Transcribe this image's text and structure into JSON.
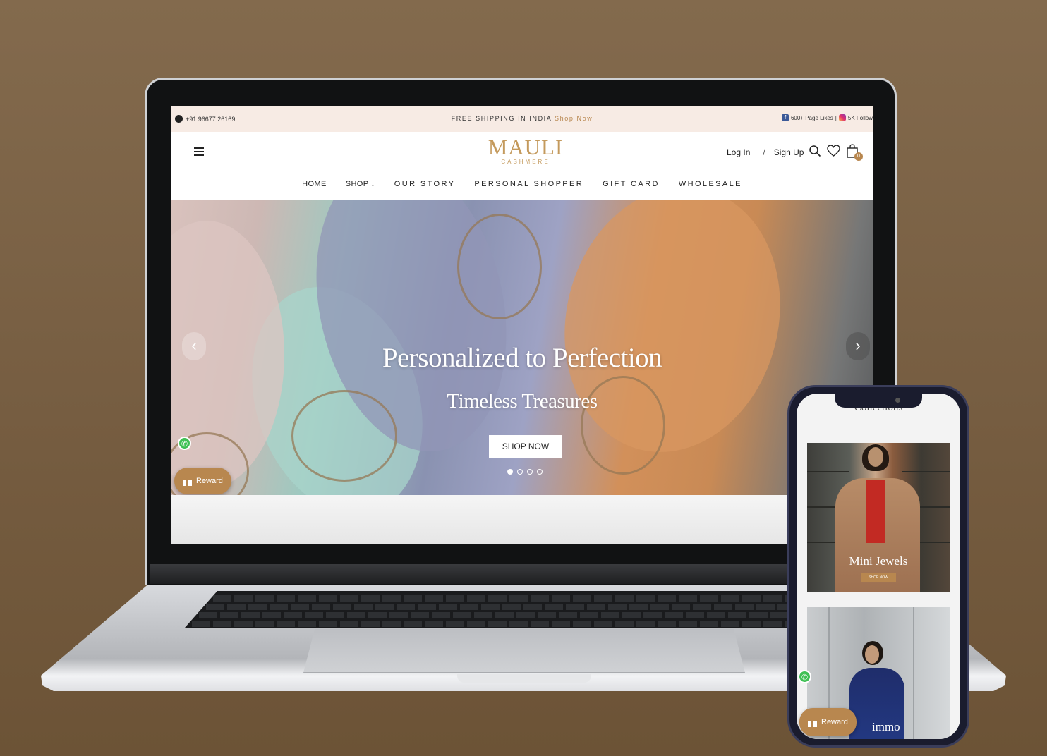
{
  "announcement": {
    "phone": "+91 96677 26169",
    "shipping_text": "FREE SHIPPING IN INDIA",
    "shipping_link": "Shop Now",
    "facebook_text": "600+ Page Likes",
    "divider": "|",
    "instagram_text": "5K Follow"
  },
  "header": {
    "logo_main": "MAULI",
    "logo_sub": "CASHMERE",
    "login_label": "Log In",
    "separator": "/",
    "signup_label": "Sign Up",
    "cart_count": "0",
    "icons": [
      "hamburger-menu-icon",
      "search-icon",
      "heart-icon",
      "shopping-bag-icon"
    ]
  },
  "nav": {
    "items": [
      "HOME",
      "SHOP",
      "OUR STORY",
      "PERSONAL SHOPPER",
      "GIFT CARD",
      "WHOLESALE"
    ],
    "dropdown_indicator": "⌄"
  },
  "hero": {
    "title": "Personalized to Perfection",
    "subtitle": "Timeless Treasures",
    "button_label": "SHOP NOW",
    "prev_arrow": "‹",
    "next_arrow": "›",
    "slide_count": 4,
    "active_slide": 1
  },
  "widgets": {
    "reward_label": "Reward",
    "whatsapp_icon": "whatsapp-icon"
  },
  "mobile": {
    "section_title": "Collections",
    "card1_title": "Mini Jewels",
    "card1_button": "SHOP NOW",
    "card2_title": "immo",
    "reward_label": "Reward"
  },
  "colors": {
    "background": "#7a6145",
    "brand_gold": "#c49a5d",
    "accent": "#b8874f",
    "announcement_bg": "#f7ebe4",
    "whatsapp": "#3fc054"
  }
}
